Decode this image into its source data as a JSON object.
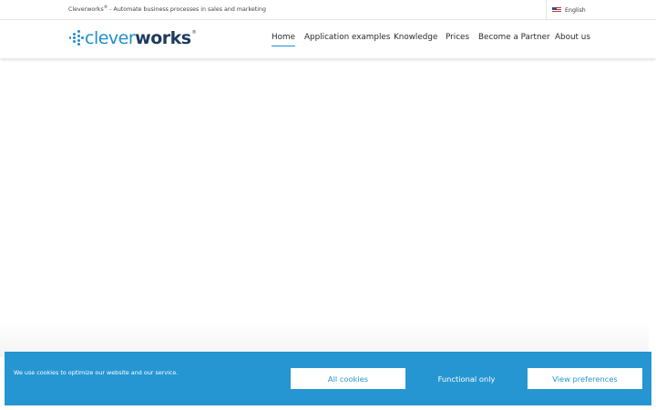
{
  "topbar": {
    "tagline_brand": "Cleverworks",
    "tagline_reg": "®",
    "tagline_rest": " - Automate business processes in sales and marketing",
    "language": "English",
    "language_flag_icon": "us-flag-icon"
  },
  "header": {
    "logo_clever": "clever",
    "logo_works": "works",
    "logo_reg": "®",
    "nav": [
      {
        "label": "Home",
        "active": true
      },
      {
        "label": "Application examples",
        "active": false
      },
      {
        "label": "Knowledge",
        "active": false
      },
      {
        "label": "Prices",
        "active": false
      },
      {
        "label": "Become a Partner",
        "active": false
      },
      {
        "label": "About us",
        "active": false
      }
    ]
  },
  "cookie_banner": {
    "message": "We use cookies to optimize our website and our service.",
    "all_cookies": "All cookies",
    "functional_only": "Functional only",
    "view_preferences": "View preferences"
  },
  "colors": {
    "brand_blue": "#2596d2",
    "brand_dark": "#1e3a5f",
    "white": "#ffffff"
  }
}
